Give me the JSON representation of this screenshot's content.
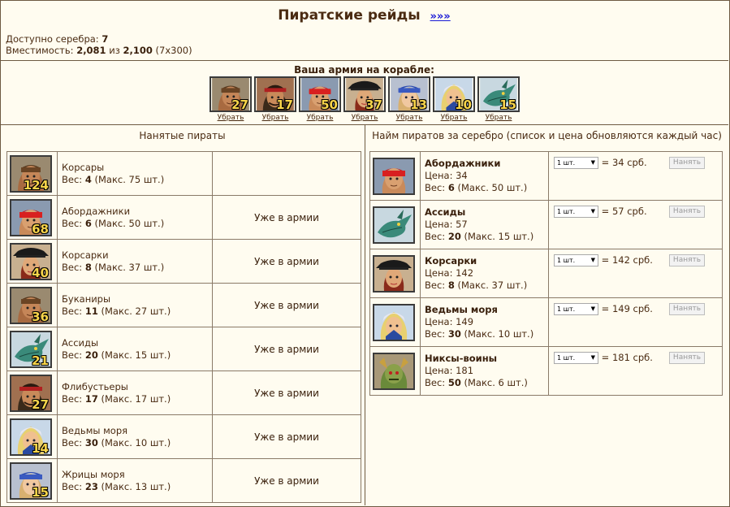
{
  "header": {
    "title": "Пиратские рейды",
    "link": "»»»",
    "silver_label": "Доступно серебра:",
    "silver_value": "7",
    "capacity_label": "Вместимость:",
    "capacity_used": "2,081",
    "capacity_of": "из",
    "capacity_max": "2,100",
    "capacity_detail": "(7x300)"
  },
  "army": {
    "title": "Ваша армия на корабле:",
    "remove_label": "Убрать",
    "units": [
      {
        "count": "27",
        "icon": "corsair-portrait-icon"
      },
      {
        "count": "17",
        "icon": "filibuster-portrait-icon"
      },
      {
        "count": "50",
        "icon": "boarder-portrait-icon"
      },
      {
        "count": "37",
        "icon": "corsairess-portrait-icon"
      },
      {
        "count": "13",
        "icon": "sea-priestess-portrait-icon"
      },
      {
        "count": "10",
        "icon": "sea-witch-portrait-icon"
      },
      {
        "count": "15",
        "icon": "assida-portrait-icon"
      }
    ]
  },
  "hired": {
    "title": "Нанятые пираты",
    "weight_label": "Вес:",
    "status_in_army": "Уже в армии",
    "rows": [
      {
        "name": "Корсары",
        "count": "124",
        "weight": "4",
        "max": "(Макс. 75 шт.)",
        "status": ""
      },
      {
        "name": "Абордажники",
        "count": "68",
        "weight": "6",
        "max": "(Макс. 50 шт.)",
        "status": "Уже в армии"
      },
      {
        "name": "Корсарки",
        "count": "40",
        "weight": "8",
        "max": "(Макс. 37 шт.)",
        "status": "Уже в армии"
      },
      {
        "name": "Буканиры",
        "count": "36",
        "weight": "11",
        "max": "(Макс. 27 шт.)",
        "status": "Уже в армии"
      },
      {
        "name": "Ассиды",
        "count": "21",
        "weight": "20",
        "max": "(Макс. 15 шт.)",
        "status": "Уже в армии"
      },
      {
        "name": "Флибустьеры",
        "count": "27",
        "weight": "17",
        "max": "(Макс. 17 шт.)",
        "status": "Уже в армии"
      },
      {
        "name": "Ведьмы моря",
        "count": "14",
        "weight": "30",
        "max": "(Макс. 10 шт.)",
        "status": "Уже в армии"
      },
      {
        "name": "Жрицы моря",
        "count": "15",
        "weight": "23",
        "max": "(Макс. 13 шт.)",
        "status": "Уже в армии"
      }
    ]
  },
  "market": {
    "title": "Найм пиратов за серебро (список и цена обновляются каждый час)",
    "price_label": "Цена:",
    "weight_label": "Вес:",
    "qty_option": "1 шт.",
    "hire_label": "Нанять",
    "rows": [
      {
        "name": "Абордажники",
        "price": "34",
        "weight": "6",
        "max": "(Макс. 50 шт.)",
        "total": "= 34 срб."
      },
      {
        "name": "Ассиды",
        "price": "57",
        "weight": "20",
        "max": "(Макс. 15 шт.)",
        "total": "= 57 срб."
      },
      {
        "name": "Корсарки",
        "price": "142",
        "weight": "8",
        "max": "(Макс. 37 шт.)",
        "total": "= 142 срб."
      },
      {
        "name": "Ведьмы моря",
        "price": "149",
        "weight": "30",
        "max": "(Макс. 10 шт.)",
        "total": "= 149 срб."
      },
      {
        "name": "Никсы-воины",
        "price": "181",
        "weight": "50",
        "max": "(Макс. 6 шт.)",
        "total": "= 181 срб."
      }
    ]
  }
}
